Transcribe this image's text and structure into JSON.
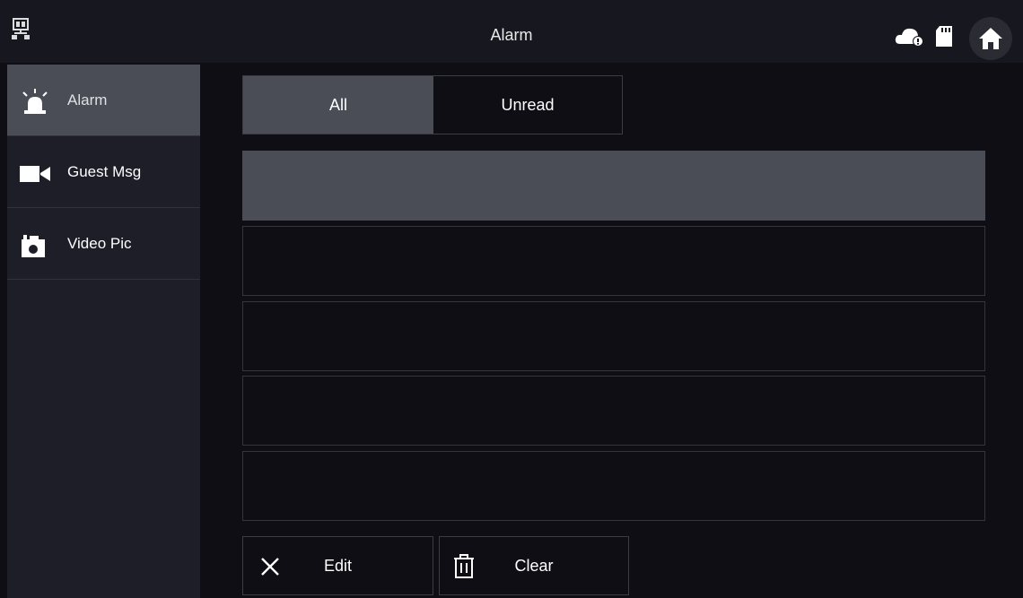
{
  "header": {
    "title": "Alarm",
    "icons": [
      "network-icon",
      "cloud-icon",
      "sd-card-icon",
      "home-icon"
    ]
  },
  "sidebar": {
    "items": [
      {
        "label": "Alarm",
        "icon": "alarm-bell-icon",
        "active": true
      },
      {
        "label": "Guest Msg",
        "icon": "video-camera-icon",
        "active": false
      },
      {
        "label": "Video Pic",
        "icon": "camera-icon",
        "active": false
      }
    ]
  },
  "tabs": [
    {
      "label": "All",
      "active": true
    },
    {
      "label": "Unread",
      "active": false
    }
  ],
  "list": {
    "selected_index": 0
  },
  "actions": {
    "edit_label": "Edit",
    "clear_label": "Clear"
  },
  "colors": {
    "background": "#0e0e14",
    "topbar": "#17171f",
    "sidebar": "#1d1e28",
    "active": "#4a4d56",
    "border": "#3b3c46"
  }
}
